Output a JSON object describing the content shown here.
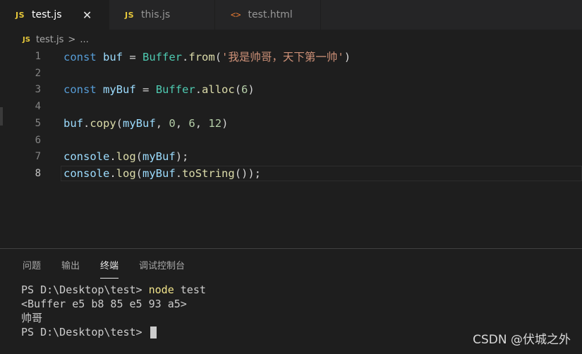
{
  "tabs": [
    {
      "icon": "JS",
      "label": "test.js",
      "close": "✕"
    },
    {
      "icon": "JS",
      "label": "this.js"
    },
    {
      "icon": "<>",
      "label": "test.html"
    }
  ],
  "breadcrumb": {
    "icon": "JS",
    "file": "test.js",
    "sep": ">",
    "rest": "..."
  },
  "editor": {
    "line_numbers": [
      "1",
      "2",
      "3",
      "4",
      "5",
      "6",
      "7",
      "8"
    ],
    "lines": [
      [
        {
          "t": "kw",
          "v": "const"
        },
        {
          "t": "pn",
          "v": " "
        },
        {
          "t": "var",
          "v": "buf"
        },
        {
          "t": "pn",
          "v": " = "
        },
        {
          "t": "cls",
          "v": "Buffer"
        },
        {
          "t": "pn",
          "v": "."
        },
        {
          "t": "fn",
          "v": "from"
        },
        {
          "t": "pn",
          "v": "("
        },
        {
          "t": "str",
          "v": "'我是帅哥，天下第一帅'"
        },
        {
          "t": "pn",
          "v": ")"
        }
      ],
      [],
      [
        {
          "t": "kw",
          "v": "const"
        },
        {
          "t": "pn",
          "v": " "
        },
        {
          "t": "var",
          "v": "myBuf"
        },
        {
          "t": "pn",
          "v": " = "
        },
        {
          "t": "cls",
          "v": "Buffer"
        },
        {
          "t": "pn",
          "v": "."
        },
        {
          "t": "fn",
          "v": "alloc"
        },
        {
          "t": "pn",
          "v": "("
        },
        {
          "t": "num",
          "v": "6"
        },
        {
          "t": "pn",
          "v": ")"
        }
      ],
      [],
      [
        {
          "t": "var",
          "v": "buf"
        },
        {
          "t": "pn",
          "v": "."
        },
        {
          "t": "fn",
          "v": "copy"
        },
        {
          "t": "pn",
          "v": "("
        },
        {
          "t": "var",
          "v": "myBuf"
        },
        {
          "t": "pn",
          "v": ", "
        },
        {
          "t": "num",
          "v": "0"
        },
        {
          "t": "pn",
          "v": ", "
        },
        {
          "t": "num",
          "v": "6"
        },
        {
          "t": "pn",
          "v": ", "
        },
        {
          "t": "num",
          "v": "12"
        },
        {
          "t": "pn",
          "v": ")"
        }
      ],
      [],
      [
        {
          "t": "var",
          "v": "console"
        },
        {
          "t": "pn",
          "v": "."
        },
        {
          "t": "fn",
          "v": "log"
        },
        {
          "t": "pn",
          "v": "("
        },
        {
          "t": "var",
          "v": "myBuf"
        },
        {
          "t": "pn",
          "v": ");"
        }
      ],
      [
        {
          "t": "var",
          "v": "console"
        },
        {
          "t": "pn",
          "v": "."
        },
        {
          "t": "fn",
          "v": "log"
        },
        {
          "t": "pn",
          "v": "("
        },
        {
          "t": "var",
          "v": "myBuf"
        },
        {
          "t": "pn",
          "v": "."
        },
        {
          "t": "fn",
          "v": "toString"
        },
        {
          "t": "pn",
          "v": "());"
        }
      ]
    ]
  },
  "panel": {
    "tabs": [
      "问题",
      "输出",
      "终端",
      "调试控制台"
    ],
    "terminal": {
      "prompt1": "PS D:\\Desktop\\test> ",
      "cmd": "node",
      "arg": " test",
      "out1": "<Buffer e5 b8 85 e5 93 a5>",
      "out2": "帅哥",
      "prompt2": "PS D:\\Desktop\\test> "
    }
  },
  "watermark": "CSDN @伏城之外"
}
